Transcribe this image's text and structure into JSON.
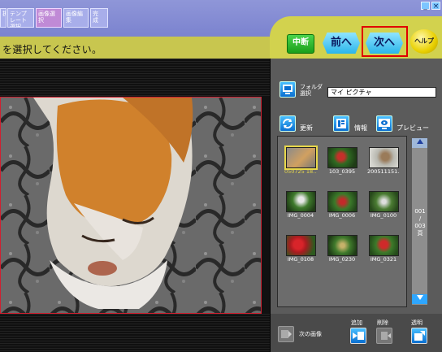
{
  "window": {
    "minimize_label": "_",
    "close_label": "×"
  },
  "steps": [
    {
      "label": "択"
    },
    {
      "label": "テンプレート選択"
    },
    {
      "label": "画像選択"
    },
    {
      "label": "画像編集"
    },
    {
      "label": "完 成"
    }
  ],
  "nav": {
    "cancel_label": "中断",
    "prev_label": "前へ",
    "next_label": "次へ",
    "help_label": "ヘルプ"
  },
  "instruction": "を選択してください。",
  "folder": {
    "label": "フォルダ 選択",
    "value": "マイ ピクチャ"
  },
  "toolbar": {
    "refresh_label": "更新",
    "info_label": "情報",
    "preview_label": "プレビュー"
  },
  "thumbnails": [
    {
      "caption": "050725 18..."
    },
    {
      "caption": "103_0395"
    },
    {
      "caption": "200511151..."
    },
    {
      "caption": "IMG_0004"
    },
    {
      "caption": "IMG_0006"
    },
    {
      "caption": "IMG_0100"
    },
    {
      "caption": "IMG_0108"
    },
    {
      "caption": "IMG_0230"
    },
    {
      "caption": "IMG_0321"
    }
  ],
  "page_indicator": {
    "current": "001",
    "separator": "/",
    "total": "003",
    "unit": "頁"
  },
  "bottom": {
    "next_image_label": "次の画像",
    "add_label": "追加",
    "delete_label": "削除",
    "transparent_label": "透明"
  },
  "colors": {
    "accent_red": "#e00000",
    "nav_cyan": "#2bb5ea",
    "band_yellow": "#c8c64f"
  }
}
